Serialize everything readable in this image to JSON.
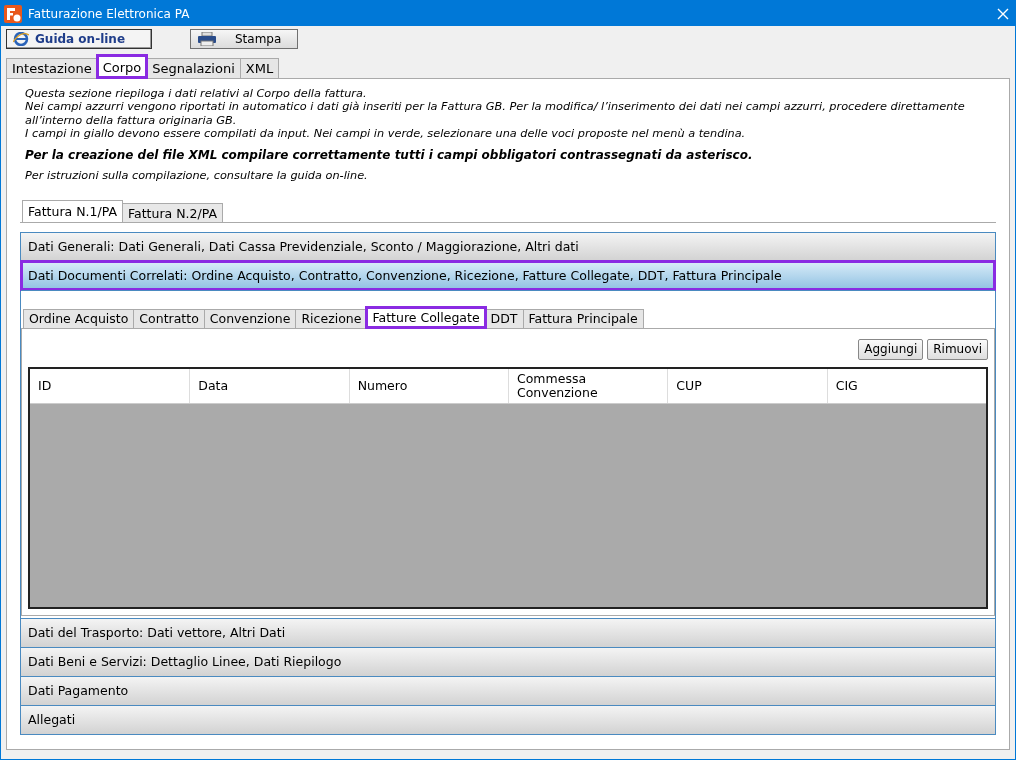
{
  "window": {
    "title": "Fatturazione Elettronica PA"
  },
  "toolbar": [
    {
      "kind": "help",
      "label": "Guida on-line"
    },
    {
      "kind": "print",
      "label": "Stampa"
    }
  ],
  "tabs": [
    {
      "label": "Intestazione",
      "selected": false
    },
    {
      "label": "Corpo",
      "selected": true
    },
    {
      "label": "Segnalazioni",
      "selected": false
    },
    {
      "label": "XML",
      "selected": false
    }
  ],
  "description": [
    {
      "kind": "normal",
      "text": "Questa sezione riepiloga i dati relativi al Corpo della fattura.\nNei campi azzurri vengono riportati in automatico i dati già inseriti per la Fattura GB. Per la modifica/ l’inserimento dei dati nei campi azzurri, procedere direttamente all’interno della fattura originaria GB.\nI campi in giallo devono essere compilati da input. Nei campi in verde, selezionare una delle voci proposte nel menù a tendina."
    },
    {
      "kind": "bold",
      "text": "Per la creazione del file XML compilare correttamente tutti i campi obbligatori contrassegnati da asterisco."
    },
    {
      "kind": "normal",
      "text": "Per istruzioni sulla compilazione, consultare la guida on-line."
    }
  ],
  "invoice_tabs": [
    {
      "label": "Fattura N.1/PA",
      "selected": true
    },
    {
      "label": "Fattura N.2/PA",
      "selected": false
    }
  ],
  "sections": [
    {
      "title": "Dati Generali: Dati Generali, Dati Cassa Previdenziale, Sconto / Maggiorazione, Altri dati",
      "expanded": false
    },
    {
      "title": "Dati Documenti Correlati: Ordine Acquisto, Contratto, Convenzione, Ricezione, Fatture Collegate, DDT, Fattura Principale",
      "expanded": true,
      "subtabs": [
        {
          "label": "Ordine Acquisto",
          "selected": false
        },
        {
          "label": "Contratto",
          "selected": false
        },
        {
          "label": "Convenzione",
          "selected": false
        },
        {
          "label": "Ricezione",
          "selected": false
        },
        {
          "label": "Fatture Collegate",
          "selected": true
        },
        {
          "label": "DDT",
          "selected": false
        },
        {
          "label": "Fattura Principale",
          "selected": false
        }
      ],
      "buttons": [
        "Aggiungi",
        "Rimuovi"
      ],
      "table": {
        "columns": [
          "ID",
          "Data",
          "Numero",
          "Commessa\nConvenzione",
          "CUP",
          "CIG"
        ]
      }
    },
    {
      "title": "Dati del Trasporto: Dati vettore, Altri Dati",
      "expanded": false
    },
    {
      "title": "Dati Beni e Servizi: Dettaglio Linee, Dati Riepilogo",
      "expanded": false
    },
    {
      "title": "Dati Pagamento",
      "expanded": false
    },
    {
      "title": "Allegati",
      "expanded": false
    }
  ]
}
